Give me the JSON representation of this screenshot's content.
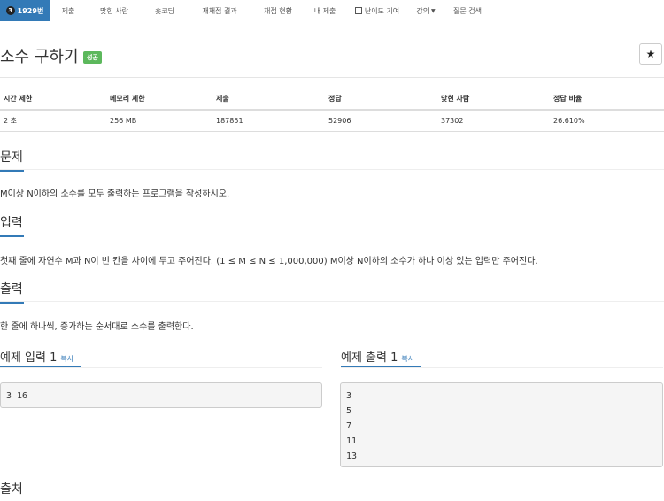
{
  "nav": {
    "problem_num": "1929번",
    "badge": "3",
    "items": [
      "제출",
      "맞힌 사람",
      "숏코딩",
      "재채점 결과",
      "채점 현황",
      "내 제출",
      "난이도 기여",
      "강의",
      "질문 검색"
    ]
  },
  "problem": {
    "title": "소수 구하기",
    "status": "성공",
    "star": "★"
  },
  "info": {
    "headers": [
      "시간 제한",
      "메모리 제한",
      "제출",
      "정답",
      "맞힌 사람",
      "정답 비율"
    ],
    "values": [
      "2 초",
      "256 MB",
      "187851",
      "52906",
      "37302",
      "26.610%"
    ]
  },
  "sections": {
    "problem_head": "문제",
    "problem_text": "M이상 N이하의 소수를 모두 출력하는 프로그램을 작성하시오.",
    "input_head": "입력",
    "input_text": "첫째 줄에 자연수 M과 N이 빈 칸을 사이에 두고 주어진다. (1 ≤ M ≤ N ≤ 1,000,000) M이상 N이하의 소수가 하나 이상 있는 입력만 주어진다.",
    "output_head": "출력",
    "output_text": "한 줄에 하나씩, 증가하는 순서대로 소수를 출력한다.",
    "source_head": "출처"
  },
  "examples": {
    "input_head": "예제 입력 1",
    "output_head": "예제 출력 1",
    "copy": "복사",
    "input_lines": [
      "3 16"
    ],
    "output_lines": [
      "3",
      "5",
      "7",
      "11",
      "13"
    ]
  },
  "colors": {
    "accent": "#337ab7",
    "success": "#5cb85c"
  }
}
